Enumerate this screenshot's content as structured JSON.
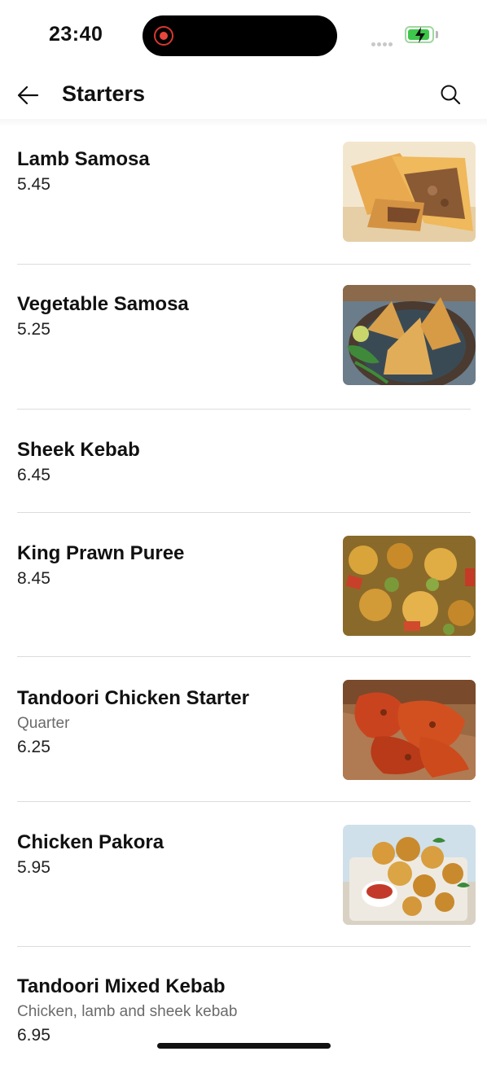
{
  "status_bar": {
    "time": "23:40",
    "battery_color": "#3ec74b",
    "recording_color": "#e8453b"
  },
  "header": {
    "title": "Starters",
    "back_icon": "arrow-left-icon",
    "search_icon": "search-icon"
  },
  "items": [
    {
      "name": "Lamb Samosa",
      "description": "",
      "price": "5.45",
      "image": "lamb-samosa-photo"
    },
    {
      "name": "Vegetable Samosa",
      "description": "",
      "price": "5.25",
      "image": "vegetable-samosa-photo"
    },
    {
      "name": "Sheek Kebab",
      "description": "",
      "price": "6.45",
      "image": ""
    },
    {
      "name": "King Prawn Puree",
      "description": "",
      "price": "8.45",
      "image": "king-prawn-puree-photo"
    },
    {
      "name": "Tandoori Chicken Starter",
      "description": "Quarter",
      "price": "6.25",
      "image": "tandoori-chicken-photo"
    },
    {
      "name": "Chicken Pakora",
      "description": "",
      "price": "5.95",
      "image": "chicken-pakora-photo"
    },
    {
      "name": "Tandoori Mixed Kebab",
      "description": "Chicken, lamb and sheek kebab",
      "price": "6.95",
      "image": ""
    }
  ]
}
